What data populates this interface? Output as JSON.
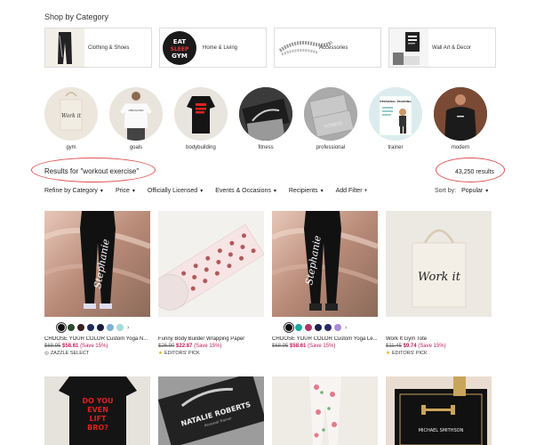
{
  "shop_by_category": {
    "title": "Shop by Category",
    "cards": [
      {
        "label": "Clothing & Shoes",
        "icon": "leggings-thumb"
      },
      {
        "label": "Home & Living",
        "icon": "button-pin-thumb"
      },
      {
        "label": "Accessories",
        "icon": "bracelet-thumb"
      },
      {
        "label": "Wall Art & Decor",
        "icon": "poster-thumb"
      }
    ],
    "eat_sleep": [
      "EAT",
      "SLEEP",
      "GYM"
    ]
  },
  "circles": [
    {
      "label": "gym"
    },
    {
      "label": "goals"
    },
    {
      "label": "bodybuilding"
    },
    {
      "label": "fitness"
    },
    {
      "label": "professional"
    },
    {
      "label": "trainer"
    },
    {
      "label": "modern"
    }
  ],
  "circle_art": {
    "tote_text": "Work it",
    "shirt_text": "ONLYGOOD",
    "fitness_text": "FITNESS",
    "trainer_heading": "PERSONAL TRAINING"
  },
  "results": {
    "label": "Results for \"workout exercise\"",
    "count": "43,250 results"
  },
  "filters": [
    {
      "label": "Refine by Category"
    },
    {
      "label": "Price"
    },
    {
      "label": "Officially Licensed"
    },
    {
      "label": "Events & Occasions"
    },
    {
      "label": "Recipients"
    },
    {
      "label": "Add Filter +"
    }
  ],
  "sort": {
    "label": "Sort by:",
    "value": "Popular"
  },
  "products": [
    {
      "title": "CHOOSE YOUR COLOR Custom Yoga N...",
      "old_price": "$68.95",
      "new_price": "$58.61",
      "save": "(Save 15%)",
      "badge": "ZAZZLE SELECT",
      "image_text": "Stephanie",
      "swatches": [
        "#111111",
        "#2e4a2e",
        "#3a1f1f",
        "#1f2a5a",
        "#1a1a3a",
        "#7fb0d6",
        "#a6dcdc"
      ]
    },
    {
      "title": "Funny Body Builder Wrapping Paper",
      "old_price": "$26.90",
      "new_price": "$22.87",
      "save": "(Save 15%)",
      "badge": "EDITORS' PICK"
    },
    {
      "title": "CHOOSE YOUR COLOR Custom Yoga Le...",
      "old_price": "$68.95",
      "new_price": "$58.61",
      "save": "(Save 15%)",
      "image_text": "Stephanie",
      "swatches": [
        "#111111",
        "#1aa89a",
        "#b0336a",
        "#1c1f4a",
        "#2a2a6a",
        "#a98bd6"
      ]
    },
    {
      "title": "Work It Gym Tote",
      "old_price": "$11.45",
      "new_price": "$9.74",
      "save": "(Save 15%)",
      "badge": "EDITORS' PICK",
      "image_text": "Work it"
    }
  ],
  "row2": {
    "shirt_text": [
      "DO YOU",
      "EVEN",
      "LIFT",
      "BRO?"
    ],
    "card_name": "NATALIE ROBERTS",
    "card_sub": "Personal Trainer",
    "gold_name": "MICHAEL SMITHSON"
  },
  "colors": {
    "accent": "#c2185b",
    "annotation": "#e05050",
    "border": "#dddddd"
  }
}
